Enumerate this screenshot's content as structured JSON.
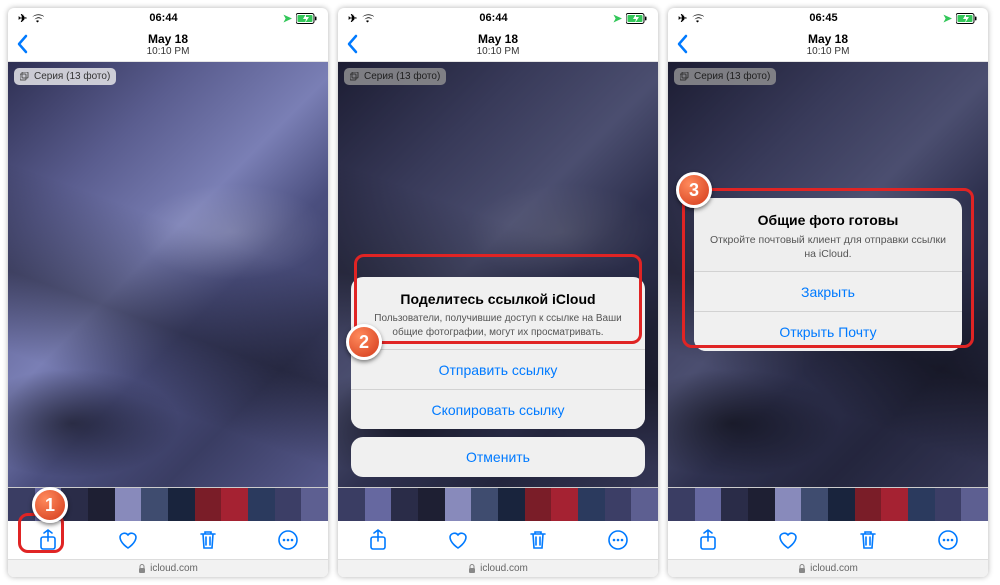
{
  "status": {
    "time1": "06:44",
    "time2": "06:44",
    "time3": "06:45"
  },
  "nav": {
    "date": "May 18",
    "time": "10:10 PM"
  },
  "badge": "Серия (13 фото)",
  "url": "icloud.com",
  "thumbs": [
    "#3a3d63",
    "#6668a0",
    "#2a2c48",
    "#1e1f33",
    "#888abb",
    "#3f4c6f",
    "#19243d",
    "#7a1d28",
    "#a52232",
    "#2b3a5e",
    "#3c3e66",
    "#5d5f91"
  ],
  "sheet": {
    "title": "Поделитесь ссылкой iCloud",
    "sub": "Пользователи, получившие доступ к ссылке на Ваши общие фотографии, могут их просматривать.",
    "send": "Отправить ссылку",
    "copy": "Скопировать ссылку",
    "cancel": "Отменить"
  },
  "alert": {
    "title": "Общие фото готовы",
    "sub": "Откройте почтовый клиент для отправки ссылки на iCloud.",
    "close": "Закрыть",
    "open": "Открыть Почту"
  },
  "callouts": {
    "c1": "1",
    "c2": "2",
    "c3": "3"
  }
}
